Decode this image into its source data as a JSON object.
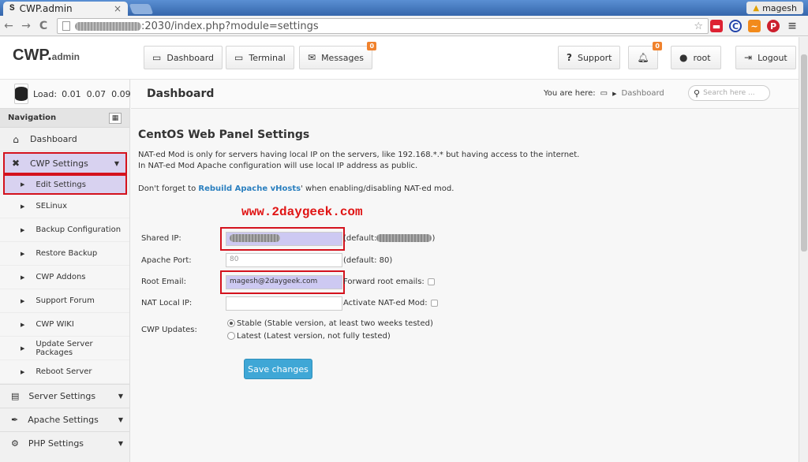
{
  "browser": {
    "tab_title": "CWP.admin",
    "tab_favicon": "S",
    "tab_close": "×",
    "user": "magesh",
    "url_suffix": ":2030/index.php?module=settings",
    "nav": {
      "back": "←",
      "forward": "→",
      "reload": "C"
    }
  },
  "header": {
    "logo_main": "CWP.",
    "logo_sub": "admin",
    "buttons": {
      "dashboard": "Dashboard",
      "terminal": "Terminal",
      "messages": "Messages",
      "messages_badge": "0",
      "support": "Support",
      "notifications_badge": "0",
      "user": "root",
      "logout": "Logout"
    }
  },
  "sidebar": {
    "load_label": "Load:",
    "load_values": "0.01  0.07  0.09",
    "nav_heading": "Navigation",
    "dashboard": "Dashboard",
    "cwp_settings": "CWP Settings",
    "sub_items": [
      "Edit Settings",
      "SELinux",
      "Backup Configuration",
      "Restore Backup",
      "CWP Addons",
      "Support Forum",
      "CWP WIKI",
      "Update Server Packages",
      "Reboot Server"
    ],
    "sections": [
      "Server Settings",
      "Apache Settings",
      "PHP Settings"
    ]
  },
  "titlebar": {
    "title": "Dashboard",
    "you_are_here": "You are here:",
    "crumb": "Dashboard",
    "search_placeholder": "Search here ..."
  },
  "main": {
    "heading": "CentOS Web Panel Settings",
    "p1_line1": "NAT-ed Mod is only for servers having local IP on the servers, like 192.168.*.* but having access to the internet.",
    "p1_line2": "In NAT-ed Mod Apache configuration will use local IP address as public.",
    "p2_pre": "Don't forget to ",
    "p2_link": "Rebuild Apache vHosts",
    "p2_post": "' when enabling/disabling NAT-ed mod.",
    "watermark": "www.2daygeek.com",
    "form": {
      "shared_ip_label": "Shared IP:",
      "shared_ip_default_pre": "(default:",
      "shared_ip_default_post": ")",
      "apache_port_label": "Apache Port:",
      "apache_port_value": "80",
      "apache_port_default": "(default: 80)",
      "root_email_label": "Root Email:",
      "root_email_value": "magesh@2daygeek.com",
      "forward_label": "Forward root emails:",
      "nat_ip_label": "NAT Local IP:",
      "nat_mod_label": "Activate NAT-ed Mod:",
      "updates_label": "CWP Updates:",
      "stable_option": "Stable (Stable version, at least two weeks tested)",
      "latest_option": "Latest (Latest version, not fully tested)"
    },
    "save_button": "Save changes"
  }
}
